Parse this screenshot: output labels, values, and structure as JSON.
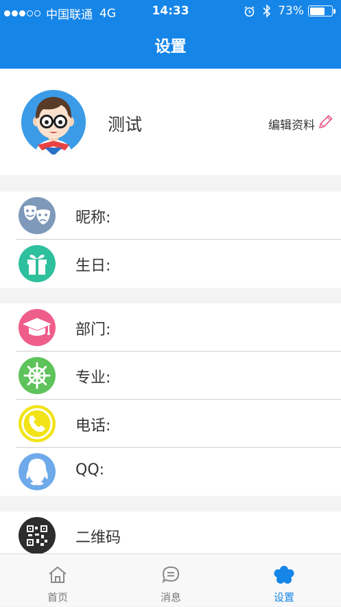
{
  "status_bar": {
    "carrier": "中国联通",
    "network": "4G",
    "time": "14:33",
    "battery_percent": "73%",
    "battery_level": 0.73,
    "signal_bars_filled": 3,
    "signal_bars_total": 5
  },
  "nav": {
    "title": "设置"
  },
  "profile": {
    "name": "测试",
    "edit_label": "编辑资料",
    "avatar_icon": "avatar-cartoon-boy-icon"
  },
  "groups": [
    {
      "rows": [
        {
          "label": "昵称:",
          "icon": "theater-masks-icon",
          "color": "#7e99b9"
        },
        {
          "label": "生日:",
          "icon": "gift-icon",
          "color": "#2ebf9d"
        }
      ]
    },
    {
      "rows": [
        {
          "label": "部门:",
          "icon": "graduation-cap-icon",
          "color": "#ef5d8b"
        },
        {
          "label": "专业:",
          "icon": "ship-wheel-icon",
          "color": "#5ec35a"
        },
        {
          "label": "电话:",
          "icon": "phone-icon",
          "color": "#f2e318"
        },
        {
          "label": "QQ:",
          "icon": "qq-penguin-icon",
          "color": "#6eaaea"
        }
      ]
    },
    {
      "rows": [
        {
          "label": "二维码",
          "icon": "qr-code-icon",
          "color": "#2d2d2d"
        }
      ]
    }
  ],
  "tabs": [
    {
      "label": "首页",
      "icon": "home-icon",
      "active": false
    },
    {
      "label": "消息",
      "icon": "message-icon",
      "active": false
    },
    {
      "label": "设置",
      "icon": "settings-flower-icon",
      "active": true
    }
  ],
  "colors": {
    "brand": "#1585e8",
    "edit_pencil": "#e8568a",
    "inactive_tab": "#777777"
  }
}
